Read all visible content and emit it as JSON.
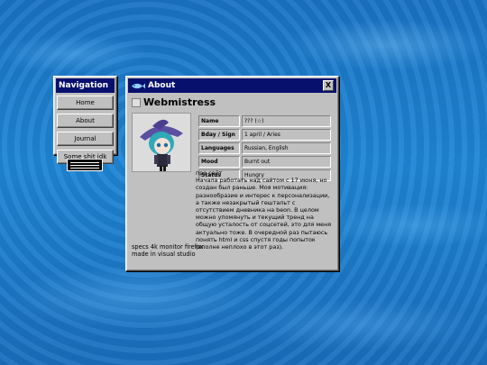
{
  "navigation": {
    "title": "Navigation",
    "items": [
      "Home",
      "About",
      "Journal",
      "Some shit idk"
    ]
  },
  "about": {
    "title": "About",
    "close_label": "X",
    "heading": "Webmistress",
    "rows": [
      {
        "key": "Name",
        "value": "??? (☆)"
      },
      {
        "key": "Bday / Sign",
        "value": "1 april / Aries"
      },
      {
        "key": "Languages",
        "value": "Russian, English"
      },
      {
        "key": "Mood",
        "value": "Burnt out"
      },
      {
        "key": "Status",
        "value": "Hungry"
      }
    ],
    "bio_heading": "про сайт",
    "bio": "Начала работать над сайтом с 17 июня, но создан был раньше. Моя мотивация: разнообразие и интерес к персонализации, а также незакрытый гештальт с отсутствием дневника на beon. В целом можно упомянуть и текущий тренд на общую усталость от соцсетей, это для меня актуально тоже. В очередной раз пытаюсь понять html и css спустя годы попыток (вполне неплохо в этот раз).",
    "specs": "specs 4k monitor firefox made in visual studio"
  },
  "colors": {
    "titlebar": "#08106e",
    "window": "#c0c0c0",
    "water": "#1f86d6"
  },
  "icons": {
    "title_icon": "fish-icon",
    "heading_icon": "broken-image-icon",
    "badge": "small-button-badge"
  }
}
